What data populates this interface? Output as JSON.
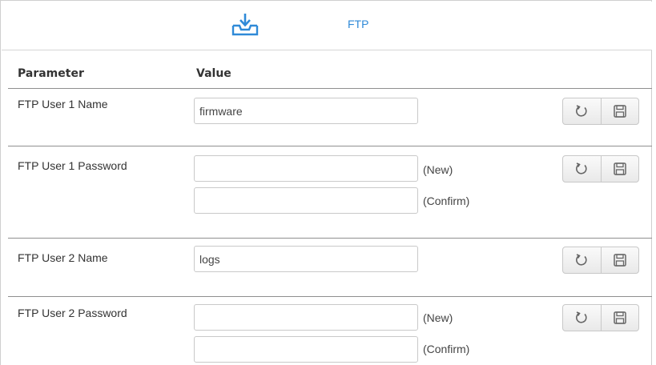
{
  "tab": {
    "label": "FTP",
    "icon": "download-tray-icon",
    "color": "#2f8ad8"
  },
  "table": {
    "headers": {
      "parameter": "Parameter",
      "value": "Value"
    },
    "rows": [
      {
        "label": "FTP User 1 Name",
        "value": "firmware"
      },
      {
        "label": "FTP User 1 Password",
        "new_value": "",
        "confirm_value": "",
        "new_hint": "(New)",
        "confirm_hint": "(Confirm)"
      },
      {
        "label": "FTP User 2 Name",
        "value": "logs"
      },
      {
        "label": "FTP User 2 Password",
        "new_value": "",
        "confirm_value": "",
        "new_hint": "(New)",
        "confirm_hint": "(Confirm)"
      }
    ]
  },
  "actions": {
    "reset_icon": "refresh-icon",
    "save_icon": "save-icon"
  }
}
